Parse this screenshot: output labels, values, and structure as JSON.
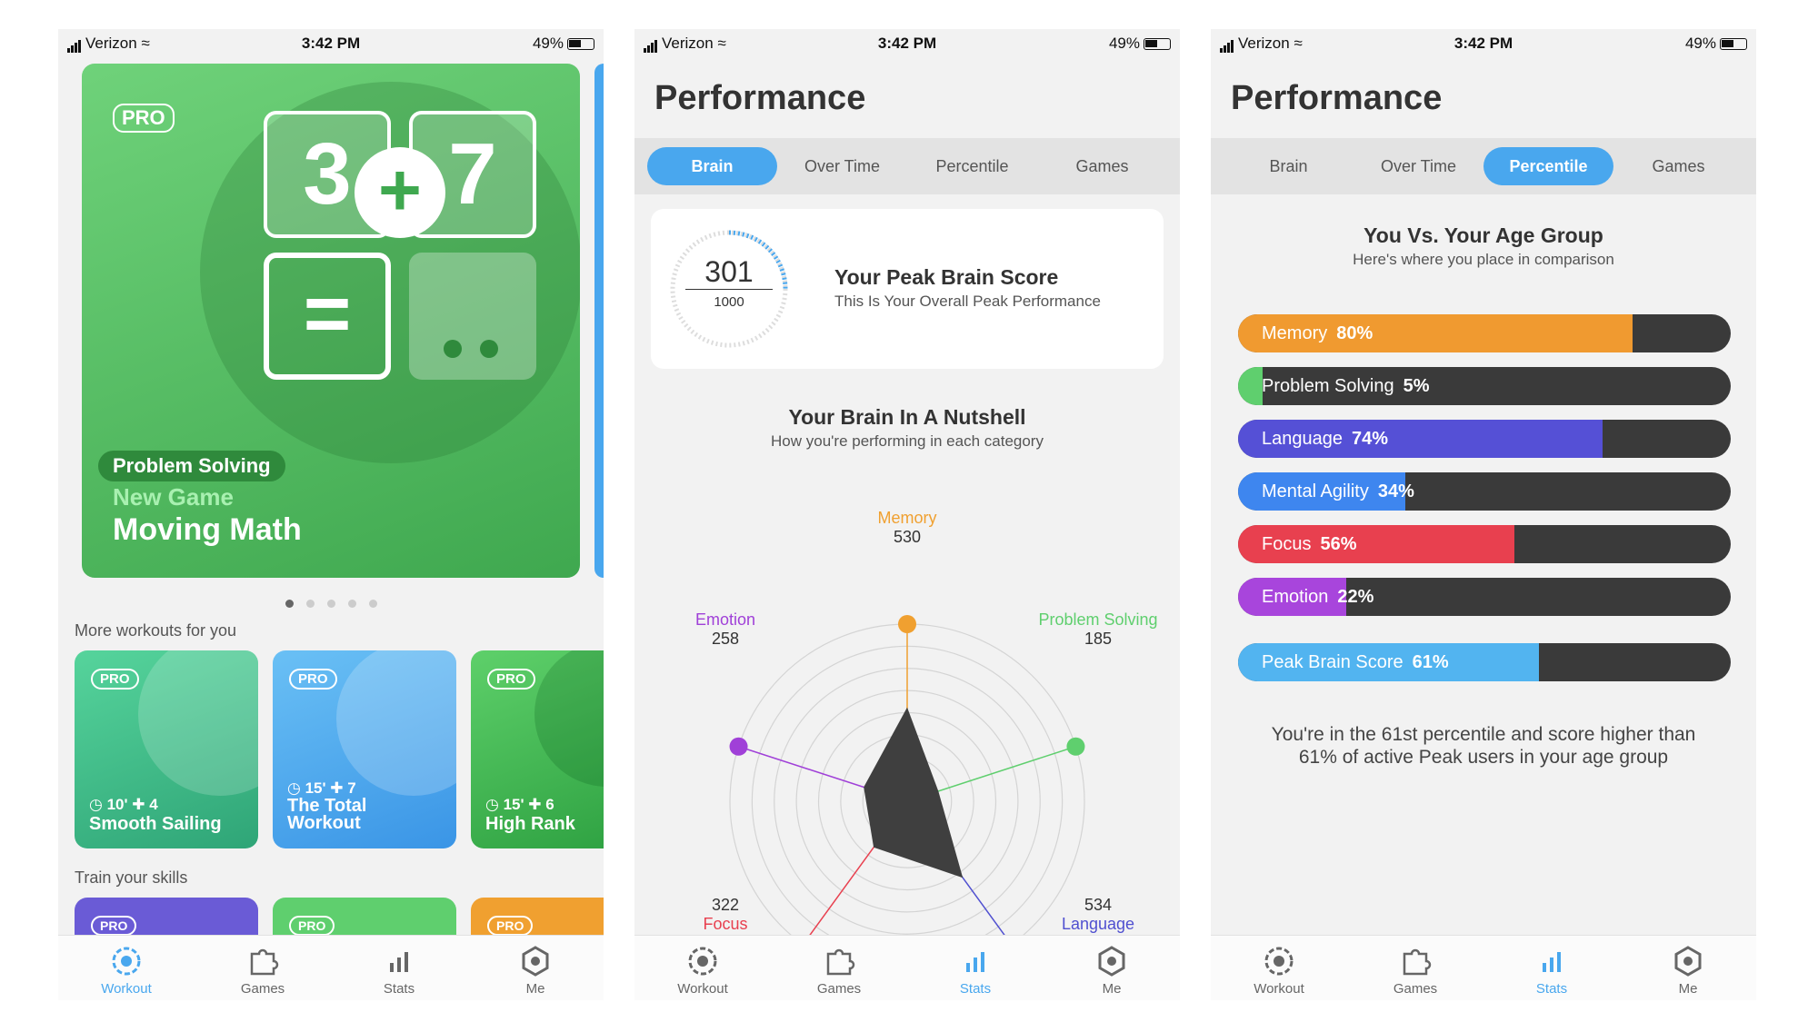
{
  "status": {
    "carrier": "Verizon",
    "time": "3:42 PM",
    "battery": "49%"
  },
  "tabs": [
    {
      "label": "Workout",
      "icon": "workout-icon"
    },
    {
      "label": "Games",
      "icon": "puzzle-icon"
    },
    {
      "label": "Stats",
      "icon": "stats-icon"
    },
    {
      "label": "Me",
      "icon": "hexagon-icon"
    }
  ],
  "screen1": {
    "hero": {
      "badge": "PRO",
      "skill": "Problem Solving",
      "subtitle": "New Game",
      "title": "Moving Math",
      "tile_a": "3",
      "tile_b": "7",
      "plus": "+",
      "equals": "="
    },
    "more_label": "More workouts for you",
    "cards": [
      {
        "badge": "PRO",
        "meta": "10'  ✚ 4",
        "title": "Smooth Sailing",
        "color": "#3bbf8a"
      },
      {
        "badge": "PRO",
        "meta": "15'  ✚ 7",
        "title": "The Total Workout",
        "color": "#49a7ee"
      },
      {
        "badge": "PRO",
        "meta": "15'  ✚ 6",
        "title": "High Rank",
        "color": "#3fb34f"
      }
    ],
    "train_label": "Train your skills",
    "skill_cards": [
      {
        "badge": "PRO",
        "color": "#6a5bd6"
      },
      {
        "badge": "PRO",
        "color": "#5fcf6e"
      },
      {
        "badge": "PRO",
        "color": "#f0a030"
      }
    ]
  },
  "screen2": {
    "title": "Performance",
    "segments": [
      "Brain",
      "Over Time",
      "Percentile",
      "Games"
    ],
    "active_segment": "Brain",
    "score": {
      "value": "301",
      "max": "1000",
      "heading": "Your Peak Brain Score",
      "sub": "This Is Your Overall Peak Performance"
    },
    "nutshell": {
      "heading": "Your Brain In A Nutshell",
      "sub": "How you're performing in each category"
    },
    "radar": [
      {
        "name": "Memory",
        "score": "530",
        "color": "#f0a030"
      },
      {
        "name": "Problem Solving",
        "score": "185",
        "color": "#5fcf6e"
      },
      {
        "name": "Language",
        "score": "534",
        "color": "#5050d0"
      },
      {
        "name": "Focus",
        "score": "322",
        "color": "#e8404f"
      },
      {
        "name": "Emotion",
        "score": "258",
        "color": "#a040d8"
      }
    ]
  },
  "screen3": {
    "title": "Performance",
    "segments": [
      "Brain",
      "Over Time",
      "Percentile",
      "Games"
    ],
    "active_segment": "Percentile",
    "heading": "You Vs. Your Age Group",
    "sub": "Here's where you place in comparison",
    "bars": [
      {
        "name": "Memory",
        "value": "80%",
        "pct": 80,
        "color": "#f09a30"
      },
      {
        "name": "Problem Solving",
        "value": "5%",
        "pct": 5,
        "color": "#5fcf6e"
      },
      {
        "name": "Language",
        "value": "74%",
        "pct": 74,
        "color": "#5550d6"
      },
      {
        "name": "Mental Agility",
        "value": "34%",
        "pct": 34,
        "color": "#3e86ef"
      },
      {
        "name": "Focus",
        "value": "56%",
        "pct": 56,
        "color": "#e8404f"
      },
      {
        "name": "Emotion",
        "value": "22%",
        "pct": 22,
        "color": "#a845dc"
      }
    ],
    "peak": {
      "name": "Peak Brain Score",
      "value": "61%",
      "pct": 61,
      "color": "#52b4f0"
    },
    "summary": "You're in the 61st percentile and score higher than 61% of active Peak users in your age group"
  }
}
